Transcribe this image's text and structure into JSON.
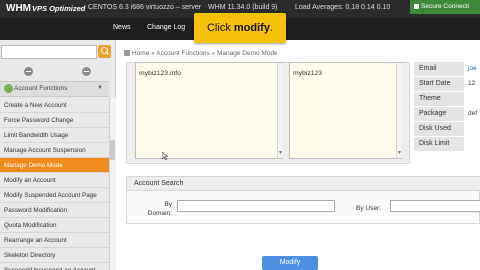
{
  "topbar": {
    "logo_main": "WHM",
    "logo_sub": "VPS Optimized",
    "os_info": "CENTOS 6.3 i686 virtuozzo – server",
    "whm_version": "WHM 11.34.0 (build 9)",
    "load_averages": "Load Averages: 0.18 0.14 0.10",
    "secure": "Secure Connecti"
  },
  "nav": {
    "news": "News",
    "changelog": "Change Log"
  },
  "tooltip": {
    "prefix": "Click ",
    "emphasis": "modify",
    "suffix": "."
  },
  "sidebar": {
    "search_placeholder": "",
    "section_label": "Account Functions",
    "items": [
      "Create a New Account",
      "Force Password Change",
      "Limit Bandwidth Usage",
      "Manage Account Suspension",
      "Manage Demo Mode",
      "Modify an Account",
      "Modify Suspended Account Page",
      "Password Modification",
      "Quota Modification",
      "Rearrange an Account",
      "Skeleton Directory",
      "Suspend/Unsuspend an Account"
    ],
    "active_index": 4
  },
  "breadcrumb": {
    "home": "Home",
    "sep": "»",
    "level1": "Account Functions",
    "level2": "Manage Demo Mode"
  },
  "listbox_left": {
    "faded_line": "...",
    "entry": "mybiz123.info"
  },
  "listbox_right": {
    "faded_line": "...",
    "entry": "mybiz123"
  },
  "info_table": [
    {
      "label": "Email",
      "value": "joe"
    },
    {
      "label": "Start Date",
      "value": "12"
    },
    {
      "label": "Theme",
      "value": ""
    },
    {
      "label": "Package",
      "value": "def"
    },
    {
      "label": "Disk Used",
      "value": ""
    },
    {
      "label": "Disk Limit",
      "value": ""
    }
  ],
  "account_search": {
    "title": "Account Search",
    "by_domain_label": "By Domain:",
    "by_user_label": "By User:",
    "by_domain_value": "",
    "by_user_value": ""
  },
  "modify_button": "Modify",
  "colors": {
    "accent_orange": "#ef8a1c",
    "tooltip_yellow": "#f4c20d",
    "button_blue": "#4a8fe0",
    "secure_green": "#3a8a3a"
  }
}
